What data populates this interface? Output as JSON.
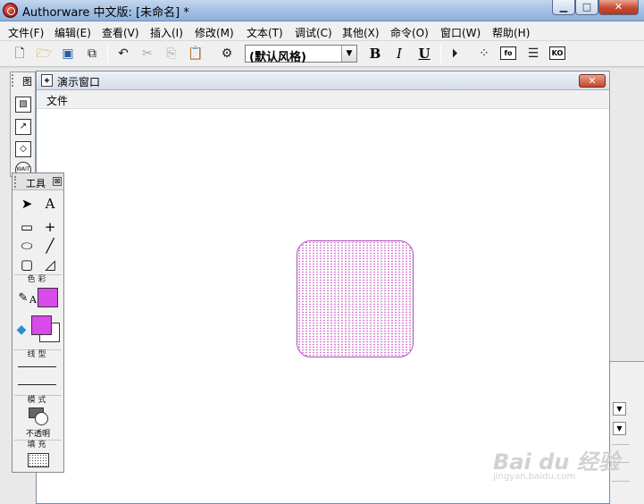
{
  "app": {
    "title": "Authorware 中文版: [未命名] *",
    "window_buttons": {
      "minimize": "▁",
      "maximize": "□",
      "close": "✕"
    }
  },
  "menubar": {
    "items": [
      "文件(F)",
      "编辑(E)",
      "查看(V)",
      "插入(I)",
      "修改(M)",
      "文本(T)",
      "调试(C)",
      "其他(X)",
      "命令(O)",
      "窗口(W)",
      "帮助(H)"
    ]
  },
  "toolbar": {
    "style_select": "(默认风格)",
    "bold": "B",
    "italic": "I",
    "underline": "U",
    "fn_button": "fo",
    "ko_button": "KO"
  },
  "icon_palette": {
    "title": "图",
    "icons": [
      "display-icon",
      "interaction-icon",
      "erase-icon",
      "wait-icon"
    ]
  },
  "presentation_window": {
    "title": "演示窗口",
    "close": "✕",
    "menu_file": "文件"
  },
  "tools_panel": {
    "title": "工具",
    "close": "⊠",
    "sections": {
      "color": "色彩",
      "line": "线型",
      "mode": "模式",
      "fill": "填充"
    },
    "mode_value": "不透明",
    "colors": {
      "line_color": "#d84bea",
      "fill_foreground": "#d84bea",
      "fill_background": "#ffffff"
    }
  },
  "canvas": {
    "shape": "rounded-rectangle",
    "border_color": "#b04cb8",
    "pattern_color": "#cc55cc"
  },
  "watermark": {
    "logo": "Bai du 经验",
    "url": "jingyan.baidu.com"
  }
}
